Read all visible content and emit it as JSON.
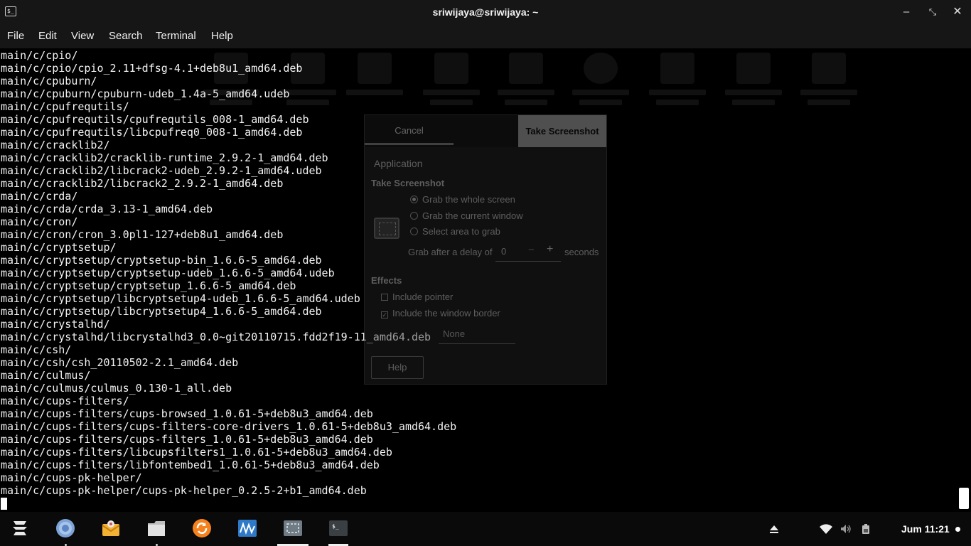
{
  "window": {
    "title": "sriwijaya@sriwijaya: ~",
    "minimize_glyph": "–",
    "maximize_glyph": "⤡",
    "close_glyph": "✕"
  },
  "menu": {
    "items": [
      "File",
      "Edit",
      "View",
      "Search",
      "Terminal",
      "Help"
    ]
  },
  "terminal": {
    "lines": [
      "main/c/cpio/",
      "main/c/cpio/cpio_2.11+dfsg-4.1+deb8u1_amd64.deb",
      "main/c/cpuburn/",
      "main/c/cpuburn/cpuburn-udeb_1.4a-5_amd64.udeb",
      "main/c/cpufrequtils/",
      "main/c/cpufrequtils/cpufrequtils_008-1_amd64.deb",
      "main/c/cpufrequtils/libcpufreq0_008-1_amd64.deb",
      "main/c/cracklib2/",
      "main/c/cracklib2/cracklib-runtime_2.9.2-1_amd64.deb",
      "main/c/cracklib2/libcrack2-udeb_2.9.2-1_amd64.udeb",
      "main/c/cracklib2/libcrack2_2.9.2-1_amd64.deb",
      "main/c/crda/",
      "main/c/crda/crda_3.13-1_amd64.deb",
      "main/c/cron/",
      "main/c/cron/cron_3.0pl1-127+deb8u1_amd64.deb",
      "main/c/cryptsetup/",
      "main/c/cryptsetup/cryptsetup-bin_1.6.6-5_amd64.deb",
      "main/c/cryptsetup/cryptsetup-udeb_1.6.6-5_amd64.udeb",
      "main/c/cryptsetup/cryptsetup_1.6.6-5_amd64.deb",
      "main/c/cryptsetup/libcryptsetup4-udeb_1.6.6-5_amd64.udeb",
      "main/c/cryptsetup/libcryptsetup4_1.6.6-5_amd64.deb",
      "main/c/crystalhd/",
      "main/c/crystalhd/libcrystalhd3_0.0~git20110715.fdd2f19-11_amd64.deb",
      "main/c/csh/",
      "main/c/csh/csh_20110502-2.1_amd64.deb",
      "main/c/culmus/",
      "main/c/culmus/culmus_0.130-1_all.deb",
      "main/c/cups-filters/",
      "main/c/cups-filters/cups-browsed_1.0.61-5+deb8u3_amd64.deb",
      "main/c/cups-filters/cups-filters-core-drivers_1.0.61-5+deb8u3_amd64.deb",
      "main/c/cups-filters/cups-filters_1.0.61-5+deb8u3_amd64.deb",
      "main/c/cups-filters/libcupsfilters1_1.0.61-5+deb8u3_amd64.deb",
      "main/c/cups-filters/libfontembed1_1.0.61-5+deb8u3_amd64.deb",
      "main/c/cups-pk-helper/",
      "main/c/cups-pk-helper/cups-pk-helper_0.2.5-2+b1_amd64.deb"
    ]
  },
  "screenshot_dialog": {
    "cancel_label": "Cancel",
    "take_label": "Take Screenshot",
    "subtitle": "Application",
    "section_take": "Take Screenshot",
    "options": [
      {
        "label": "Grab the whole screen",
        "selected": true
      },
      {
        "label": "Grab the current window",
        "selected": false
      },
      {
        "label": "Select area to grab",
        "selected": false
      }
    ],
    "delay_label": "Grab after a delay of",
    "delay_value": "0",
    "minus": "−",
    "plus": "+",
    "seconds_label": "seconds",
    "section_effects": "Effects",
    "include_pointer": {
      "label": "Include pointer",
      "checked": false
    },
    "include_border": {
      "label": "Include the window border",
      "checked": true
    },
    "effect_value": "None",
    "help_label": "Help"
  },
  "taskbar": {
    "apps": [
      "zorin-menu-icon",
      "chromium-icon",
      "mail-icon",
      "files-icon",
      "software-updater-icon",
      "system-monitor-icon",
      "screenshot-icon",
      "terminal-icon"
    ],
    "clock": "Jum 11:21"
  },
  "colors": {
    "titlebar": "#161616",
    "terminal_bg": "#000000",
    "terminal_fg": "#f2f2f2",
    "taskbar": "#0a0a0a"
  }
}
